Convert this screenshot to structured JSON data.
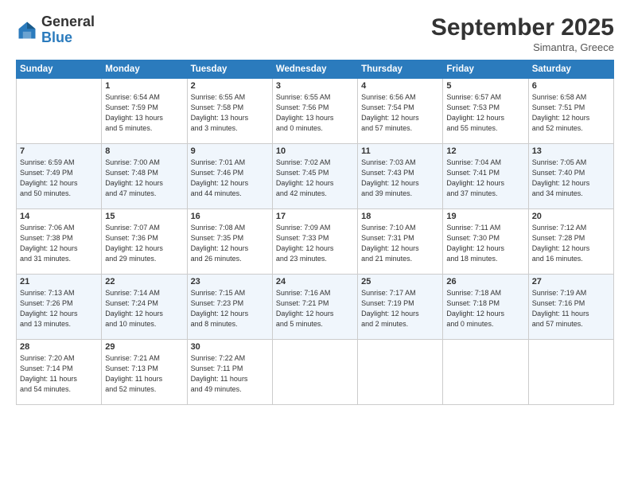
{
  "logo": {
    "general": "General",
    "blue": "Blue"
  },
  "title": "September 2025",
  "subtitle": "Simantra, Greece",
  "days_header": [
    "Sunday",
    "Monday",
    "Tuesday",
    "Wednesday",
    "Thursday",
    "Friday",
    "Saturday"
  ],
  "weeks": [
    [
      {
        "day": "",
        "info": ""
      },
      {
        "day": "1",
        "info": "Sunrise: 6:54 AM\nSunset: 7:59 PM\nDaylight: 13 hours\nand 5 minutes."
      },
      {
        "day": "2",
        "info": "Sunrise: 6:55 AM\nSunset: 7:58 PM\nDaylight: 13 hours\nand 3 minutes."
      },
      {
        "day": "3",
        "info": "Sunrise: 6:55 AM\nSunset: 7:56 PM\nDaylight: 13 hours\nand 0 minutes."
      },
      {
        "day": "4",
        "info": "Sunrise: 6:56 AM\nSunset: 7:54 PM\nDaylight: 12 hours\nand 57 minutes."
      },
      {
        "day": "5",
        "info": "Sunrise: 6:57 AM\nSunset: 7:53 PM\nDaylight: 12 hours\nand 55 minutes."
      },
      {
        "day": "6",
        "info": "Sunrise: 6:58 AM\nSunset: 7:51 PM\nDaylight: 12 hours\nand 52 minutes."
      }
    ],
    [
      {
        "day": "7",
        "info": "Sunrise: 6:59 AM\nSunset: 7:49 PM\nDaylight: 12 hours\nand 50 minutes."
      },
      {
        "day": "8",
        "info": "Sunrise: 7:00 AM\nSunset: 7:48 PM\nDaylight: 12 hours\nand 47 minutes."
      },
      {
        "day": "9",
        "info": "Sunrise: 7:01 AM\nSunset: 7:46 PM\nDaylight: 12 hours\nand 44 minutes."
      },
      {
        "day": "10",
        "info": "Sunrise: 7:02 AM\nSunset: 7:45 PM\nDaylight: 12 hours\nand 42 minutes."
      },
      {
        "day": "11",
        "info": "Sunrise: 7:03 AM\nSunset: 7:43 PM\nDaylight: 12 hours\nand 39 minutes."
      },
      {
        "day": "12",
        "info": "Sunrise: 7:04 AM\nSunset: 7:41 PM\nDaylight: 12 hours\nand 37 minutes."
      },
      {
        "day": "13",
        "info": "Sunrise: 7:05 AM\nSunset: 7:40 PM\nDaylight: 12 hours\nand 34 minutes."
      }
    ],
    [
      {
        "day": "14",
        "info": "Sunrise: 7:06 AM\nSunset: 7:38 PM\nDaylight: 12 hours\nand 31 minutes."
      },
      {
        "day": "15",
        "info": "Sunrise: 7:07 AM\nSunset: 7:36 PM\nDaylight: 12 hours\nand 29 minutes."
      },
      {
        "day": "16",
        "info": "Sunrise: 7:08 AM\nSunset: 7:35 PM\nDaylight: 12 hours\nand 26 minutes."
      },
      {
        "day": "17",
        "info": "Sunrise: 7:09 AM\nSunset: 7:33 PM\nDaylight: 12 hours\nand 23 minutes."
      },
      {
        "day": "18",
        "info": "Sunrise: 7:10 AM\nSunset: 7:31 PM\nDaylight: 12 hours\nand 21 minutes."
      },
      {
        "day": "19",
        "info": "Sunrise: 7:11 AM\nSunset: 7:30 PM\nDaylight: 12 hours\nand 18 minutes."
      },
      {
        "day": "20",
        "info": "Sunrise: 7:12 AM\nSunset: 7:28 PM\nDaylight: 12 hours\nand 16 minutes."
      }
    ],
    [
      {
        "day": "21",
        "info": "Sunrise: 7:13 AM\nSunset: 7:26 PM\nDaylight: 12 hours\nand 13 minutes."
      },
      {
        "day": "22",
        "info": "Sunrise: 7:14 AM\nSunset: 7:24 PM\nDaylight: 12 hours\nand 10 minutes."
      },
      {
        "day": "23",
        "info": "Sunrise: 7:15 AM\nSunset: 7:23 PM\nDaylight: 12 hours\nand 8 minutes."
      },
      {
        "day": "24",
        "info": "Sunrise: 7:16 AM\nSunset: 7:21 PM\nDaylight: 12 hours\nand 5 minutes."
      },
      {
        "day": "25",
        "info": "Sunrise: 7:17 AM\nSunset: 7:19 PM\nDaylight: 12 hours\nand 2 minutes."
      },
      {
        "day": "26",
        "info": "Sunrise: 7:18 AM\nSunset: 7:18 PM\nDaylight: 12 hours\nand 0 minutes."
      },
      {
        "day": "27",
        "info": "Sunrise: 7:19 AM\nSunset: 7:16 PM\nDaylight: 11 hours\nand 57 minutes."
      }
    ],
    [
      {
        "day": "28",
        "info": "Sunrise: 7:20 AM\nSunset: 7:14 PM\nDaylight: 11 hours\nand 54 minutes."
      },
      {
        "day": "29",
        "info": "Sunrise: 7:21 AM\nSunset: 7:13 PM\nDaylight: 11 hours\nand 52 minutes."
      },
      {
        "day": "30",
        "info": "Sunrise: 7:22 AM\nSunset: 7:11 PM\nDaylight: 11 hours\nand 49 minutes."
      },
      {
        "day": "",
        "info": ""
      },
      {
        "day": "",
        "info": ""
      },
      {
        "day": "",
        "info": ""
      },
      {
        "day": "",
        "info": ""
      }
    ]
  ]
}
